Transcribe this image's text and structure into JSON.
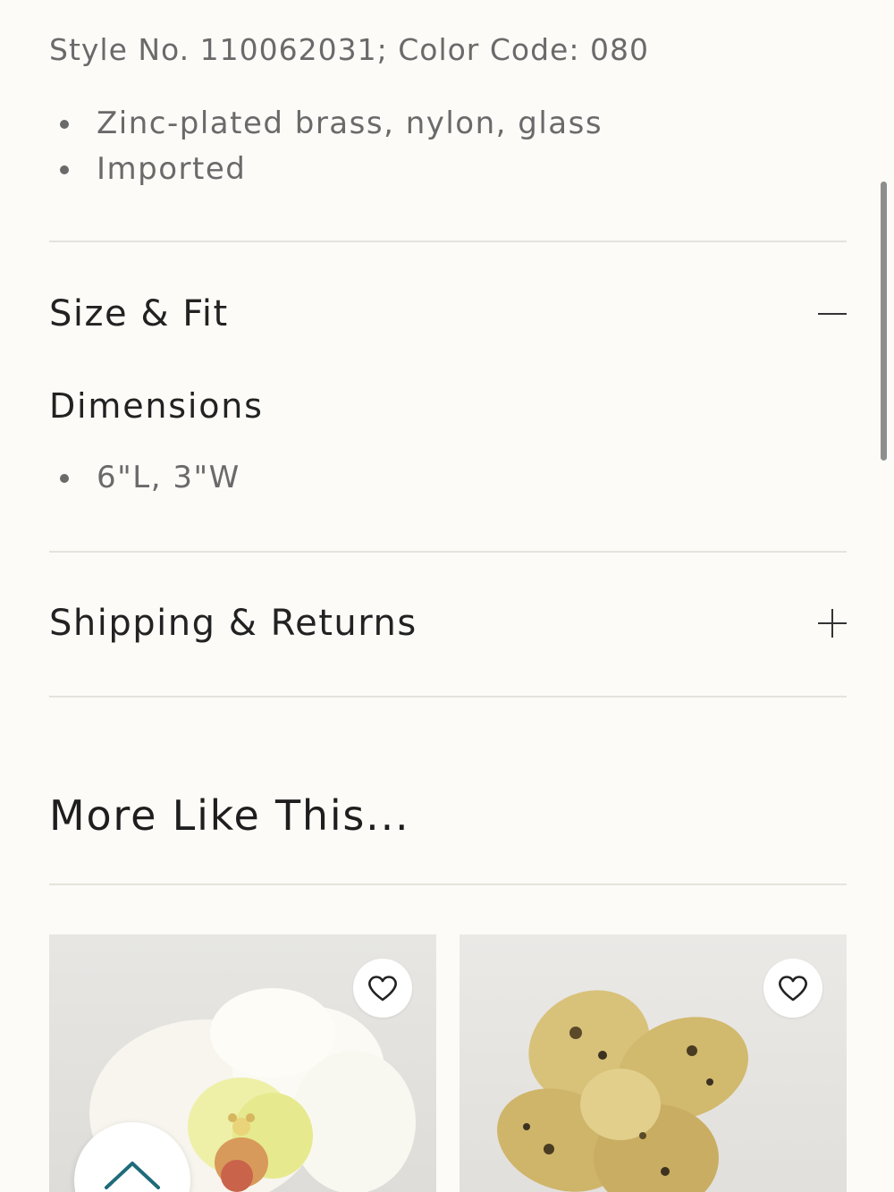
{
  "product_details": {
    "style_line": "Style No. 110062031; Color Code: 080",
    "bullets": [
      "Zinc-plated brass, nylon, glass",
      "Imported"
    ]
  },
  "size_fit": {
    "title": "Size & Fit",
    "toggle_state": "expanded",
    "subheading": "Dimensions",
    "bullets": [
      "6\"L, 3\"W"
    ]
  },
  "shipping": {
    "title": "Shipping & Returns",
    "toggle_state": "collapsed"
  },
  "more_like_this": {
    "title": "More Like This...",
    "products": [
      {
        "image_icon": "white-orchid-hair-clip",
        "favorite_icon": "heart-icon"
      },
      {
        "image_icon": "gold-flower-brooch",
        "favorite_icon": "heart-icon"
      }
    ]
  },
  "colors": {
    "background": "#fcfbf8",
    "text": "#222222",
    "muted_text": "#6a6a6a",
    "divider": "#e6e2dc",
    "scroll_top_arrow": "#1f6b7a"
  }
}
